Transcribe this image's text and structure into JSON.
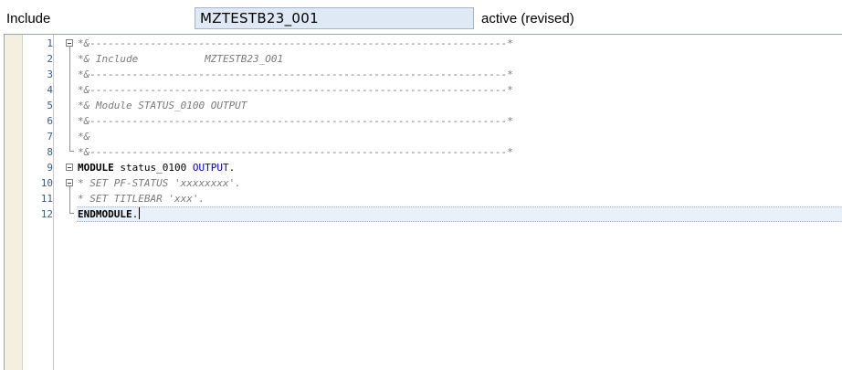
{
  "header": {
    "label": "Include",
    "include_name": "MZTESTB23_001",
    "status": "active (revised)"
  },
  "editor": {
    "lines": [
      {
        "num": "1",
        "text": "*&---------------------------------------------------------------------*"
      },
      {
        "num": "2",
        "text": "*& Include           MZTESTB23_O01"
      },
      {
        "num": "3",
        "text": "*&---------------------------------------------------------------------*"
      },
      {
        "num": "4",
        "text": "*&---------------------------------------------------------------------*"
      },
      {
        "num": "5",
        "text": "*& Module STATUS_0100 OUTPUT"
      },
      {
        "num": "6",
        "text": "*&---------------------------------------------------------------------*"
      },
      {
        "num": "7",
        "text": "*&"
      },
      {
        "num": "8",
        "text": "*&---------------------------------------------------------------------*"
      },
      {
        "num": "9",
        "kw1": "MODULE",
        "mid": " status_0100 ",
        "kw2": "OUTPUT",
        "end": "."
      },
      {
        "num": "10",
        "text": "* SET PF-STATUS 'xxxxxxxx'."
      },
      {
        "num": "11",
        "text": "* SET TITLEBAR 'xxx'."
      },
      {
        "num": "12",
        "kw1": "ENDMODULE",
        "end": "."
      }
    ]
  }
}
